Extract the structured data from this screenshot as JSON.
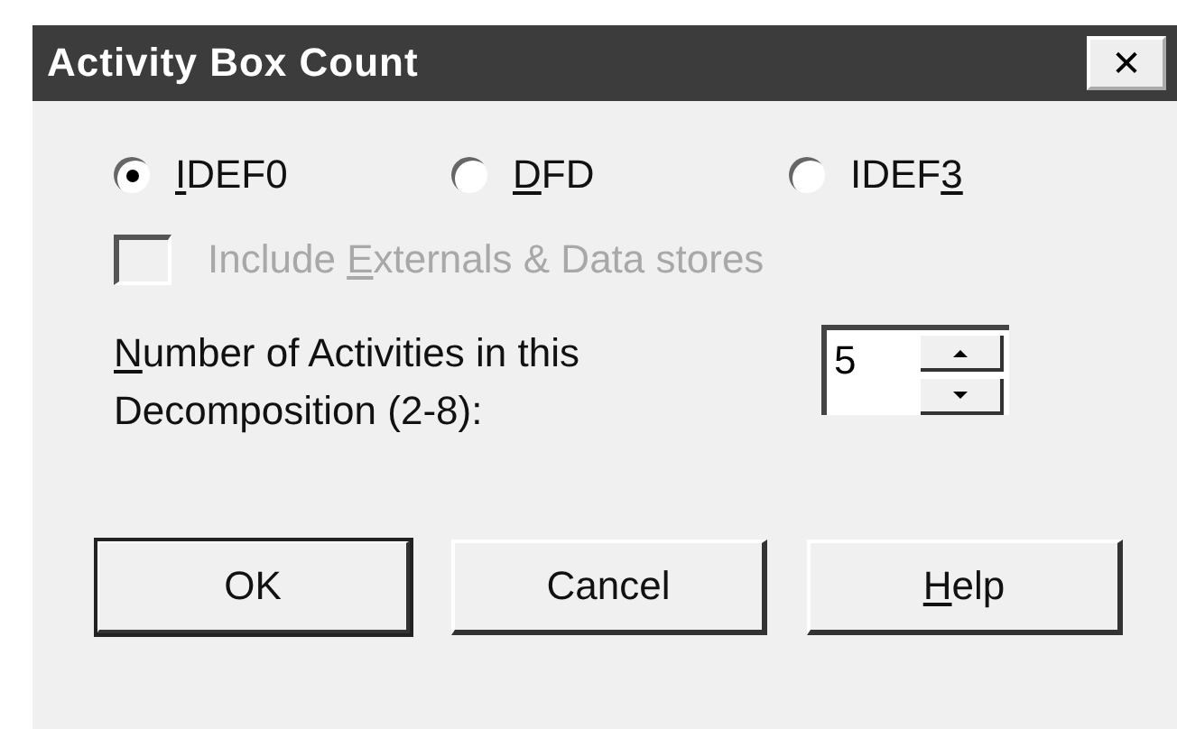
{
  "window": {
    "title": "Activity Box Count",
    "close": "✕"
  },
  "radios": [
    {
      "key": "I",
      "after": "DEF0",
      "selected": true
    },
    {
      "key": "D",
      "after": "FD",
      "selected": false
    },
    {
      "before": "IDEF",
      "key": "3",
      "selected": false
    }
  ],
  "checkbox": {
    "before": "Include ",
    "key": "E",
    "after": "xternals & Data stores",
    "checked": false,
    "disabled": true
  },
  "spin": {
    "label_lines": [
      {
        "key": "N",
        "after": "umber of Activities in this"
      },
      {
        "before": "Decomposition (2-8):"
      }
    ],
    "value": "5"
  },
  "buttons": [
    {
      "before": "OK",
      "default": true
    },
    {
      "before": "Cancel",
      "default": false
    },
    {
      "key": "H",
      "after": "elp",
      "default": false
    }
  ]
}
